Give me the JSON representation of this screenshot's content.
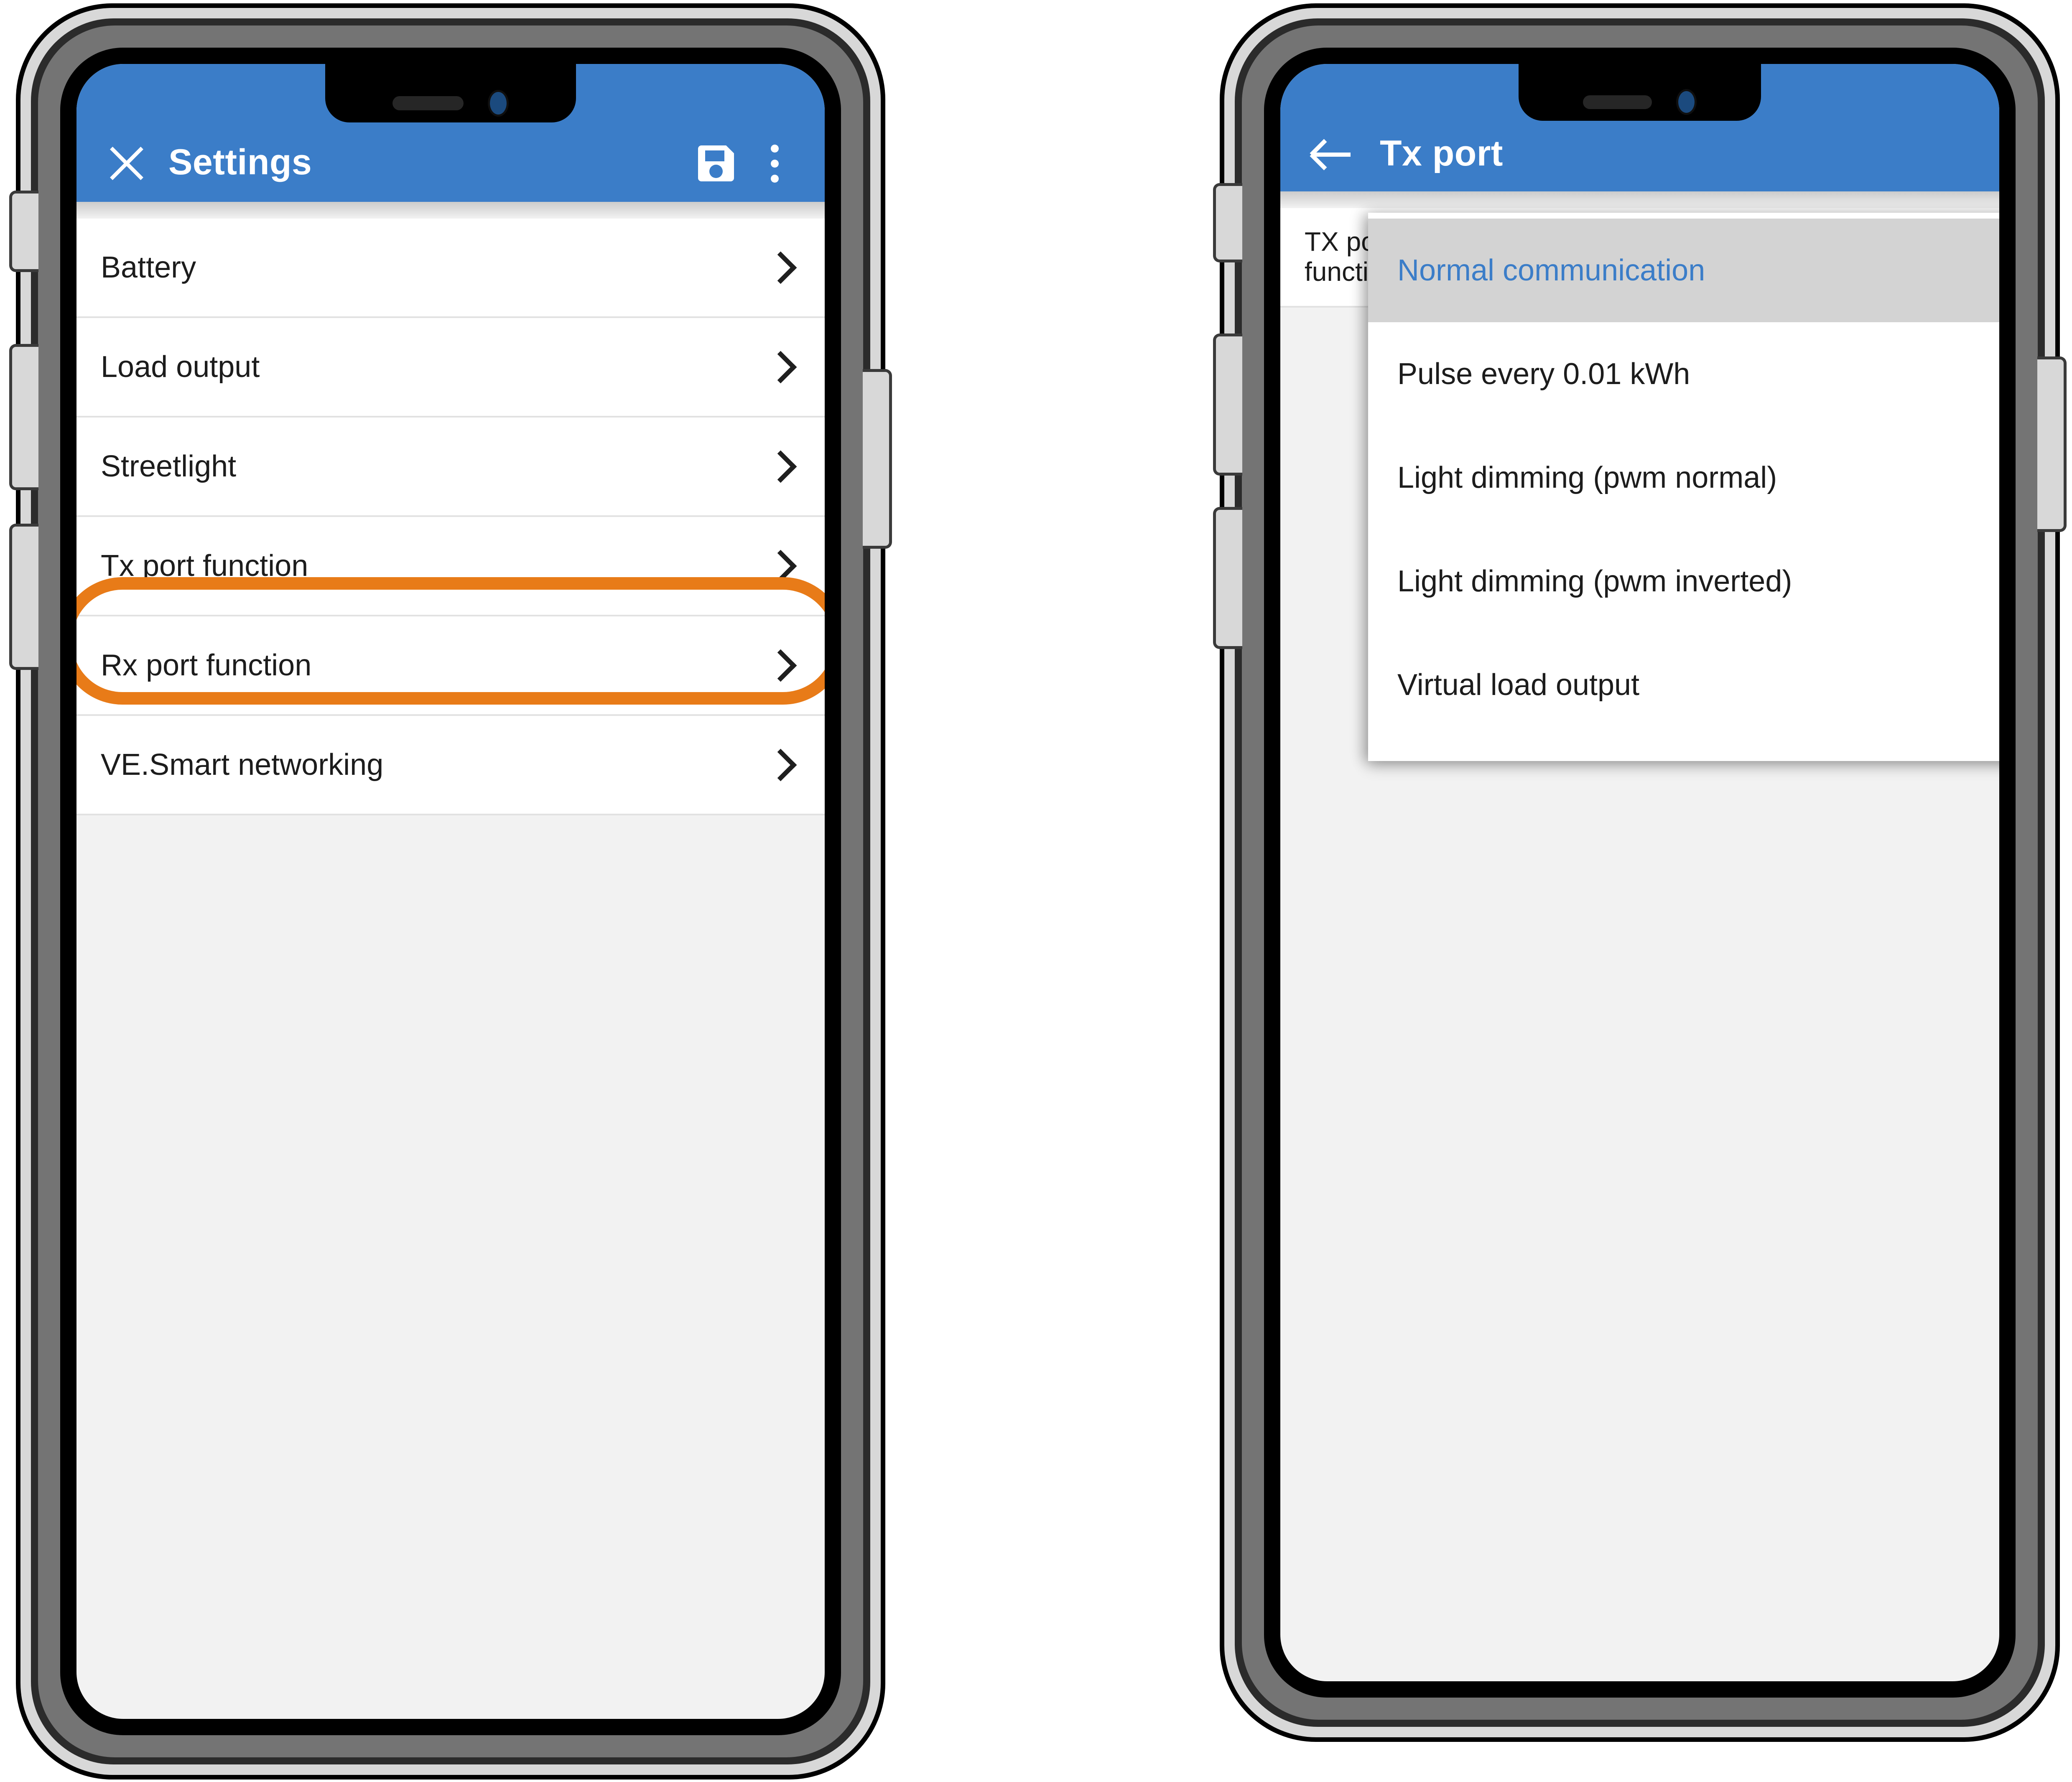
{
  "colors": {
    "app_bar_blue": "#3b7dc8",
    "highlight_orange": "#e87b18",
    "selected_row_grey": "#d3d3d3",
    "selected_text_blue": "#3b7dc8",
    "screen_background": "#f2f2f2",
    "list_background": "#ffffff",
    "divider": "#e2e2e2"
  },
  "left_phone": {
    "app_bar": {
      "title": "Settings",
      "close_icon": "close-x-icon",
      "save_icon": "floppy-save-icon",
      "overflow_icon": "kebab-menu-icon"
    },
    "settings_list": [
      {
        "label": "Battery",
        "chevron": "chevron-right-icon",
        "highlighted": false
      },
      {
        "label": "Load output",
        "chevron": "chevron-right-icon",
        "highlighted": false
      },
      {
        "label": "Streetlight",
        "chevron": "chevron-right-icon",
        "highlighted": false
      },
      {
        "label": "Tx port function",
        "chevron": "chevron-right-icon",
        "highlighted": true
      },
      {
        "label": "Rx port function",
        "chevron": "chevron-right-icon",
        "highlighted": false
      },
      {
        "label": "VE.Smart networking",
        "chevron": "chevron-right-icon",
        "highlighted": false
      }
    ]
  },
  "right_phone": {
    "app_bar": {
      "title": "Tx port",
      "back_icon": "arrow-left-icon"
    },
    "base_row_label": "TX port function",
    "dropdown": {
      "selected": "Normal communication",
      "options": [
        "Normal communication",
        "Pulse every 0.01 kWh",
        "Light dimming (pwm normal)",
        "Light dimming (pwm inverted)",
        "Virtual load output"
      ]
    }
  }
}
